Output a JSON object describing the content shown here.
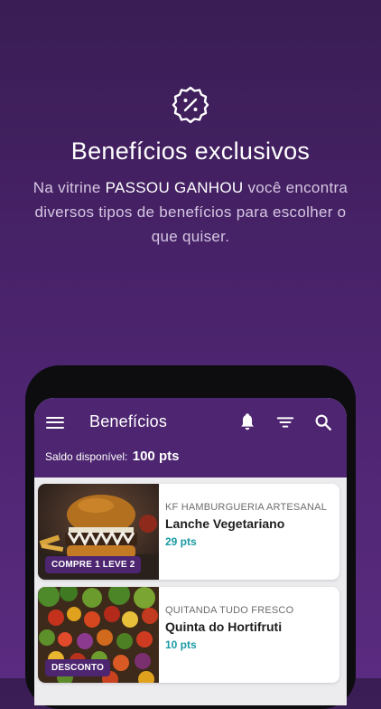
{
  "hero": {
    "title": "Benefícios exclusivos",
    "desc_before": "Na vitrine ",
    "desc_brand": "PASSOU GANHOU",
    "desc_after": " você encontra diversos tipos de benefícios para escolher o que quiser.",
    "badge_icon": "discount-badge-icon"
  },
  "app": {
    "title": "Benefícios",
    "icons": [
      "menu-icon",
      "bell-icon",
      "filter-icon",
      "search-icon"
    ],
    "balance_label": "Saldo disponível:",
    "balance_value": "100 pts"
  },
  "offers": [
    {
      "store": "KF HAMBURGUERIA ARTESANAL",
      "name": "Lanche Vegetariano",
      "points": "29 pts",
      "tag": "COMPRE 1 LEVE 2",
      "image": "burger-photo"
    },
    {
      "store": "QUITANDA TUDO FRESCO",
      "name": "Quinta do Hortifruti",
      "points": "10 pts",
      "tag": "DESCONTO",
      "image": "produce-photo"
    }
  ],
  "colors": {
    "brand": "#4d2570",
    "points": "#1a9aa3",
    "background": "#4a236c"
  }
}
